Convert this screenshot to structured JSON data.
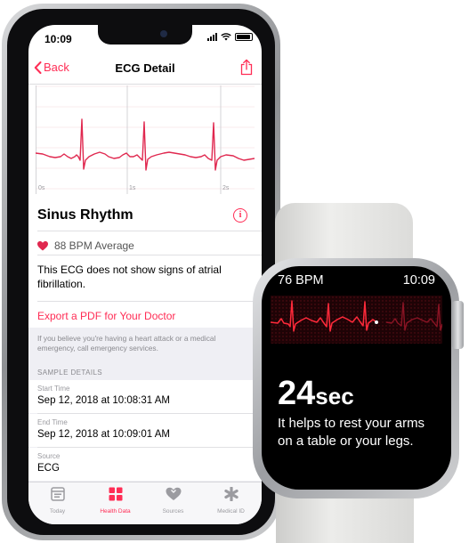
{
  "phone": {
    "status_time": "10:09",
    "nav": {
      "back_label": "Back",
      "title": "ECG Detail",
      "share_icon": "share-icon"
    },
    "ecg_ticks": [
      "0s",
      "1s",
      "2s"
    ],
    "result": {
      "title": "Sinus Rhythm",
      "info_glyph": "i"
    },
    "bpm_text": "88 BPM Average",
    "description": "This ECG does not show signs of atrial fibrillation.",
    "export_label": "Export a PDF for Your Doctor",
    "emergency_note": "If you believe you're having a heart attack or a medical emergency, call emergency services.",
    "sample_header": "SAMPLE DETAILS",
    "details": [
      {
        "label": "Start Time",
        "value": "Sep 12, 2018 at 10:08:31 AM"
      },
      {
        "label": "End Time",
        "value": "Sep 12, 2018 at 10:09:01 AM"
      },
      {
        "label": "Source",
        "value": "ECG"
      }
    ],
    "tabs": [
      {
        "label": "Today",
        "icon": "today-icon"
      },
      {
        "label": "Health Data",
        "icon": "health-data-icon"
      },
      {
        "label": "Sources",
        "icon": "sources-icon"
      },
      {
        "label": "Medical ID",
        "icon": "medical-id-icon"
      }
    ],
    "colors": {
      "accent": "#ff2d55",
      "ecg_line": "#e0284f",
      "grid": "#f2d7dd"
    }
  },
  "watch": {
    "bpm": "76 BPM",
    "time": "10:09",
    "counter_value": "24",
    "counter_unit": "sec",
    "message": "It helps to rest your arms on a table or your legs."
  }
}
